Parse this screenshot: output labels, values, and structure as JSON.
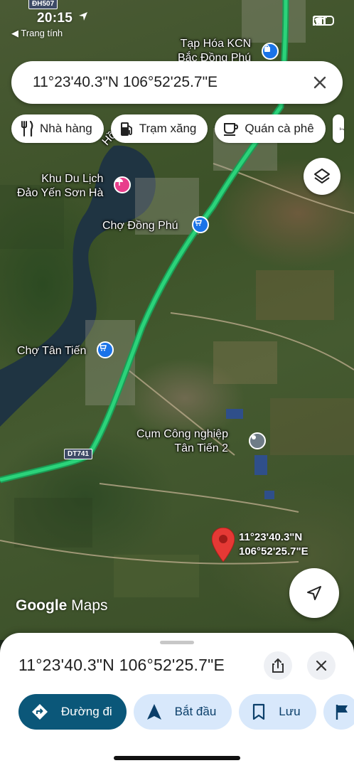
{
  "status": {
    "time": "20:15",
    "back_app": "◀ Trang tính",
    "road_badge_top": "ĐH507"
  },
  "search": {
    "query": "11°23'40.3\"N 106°52'25.7\"E"
  },
  "chips": [
    {
      "label": "Nhà hàng",
      "icon": "fork-knife-icon"
    },
    {
      "label": "Trạm xăng",
      "icon": "gas-station-icon"
    },
    {
      "label": "Quán cà phê",
      "icon": "coffee-cup-icon"
    }
  ],
  "map": {
    "places": {
      "tap_hoa": "Tạp Hóa KCN\nBắc Đồng Phú",
      "khu_du_lich": "Khu Du Lịch\nĐảo Yến Sơn Hà",
      "cho_dong_phu": "Chợ Đồng Phú",
      "cho_tan_tien": "Chợ Tân Tiến",
      "cum_cong_nghiep": "Cụm Công nghiệp\nTân Tiến 2",
      "ho_label": "Hồ"
    },
    "road_label": "DT741",
    "dropped_pin_label": "11°23'40.3\"N\n106°52'25.7\"E",
    "watermark": "Google Maps"
  },
  "sheet": {
    "title": "11°23'40.3\"N 106°52'25.7\"E",
    "actions": [
      {
        "label": "Đường đi",
        "icon": "directions-icon"
      },
      {
        "label": "Bắt đầu",
        "icon": "navigation-arrow-icon"
      },
      {
        "label": "Lưu",
        "icon": "bookmark-icon"
      }
    ]
  },
  "colors": {
    "primary_button": "#0b5779",
    "secondary_button": "#d8e8fb",
    "highway": "#2bd37a",
    "pin_red": "#e53935"
  }
}
